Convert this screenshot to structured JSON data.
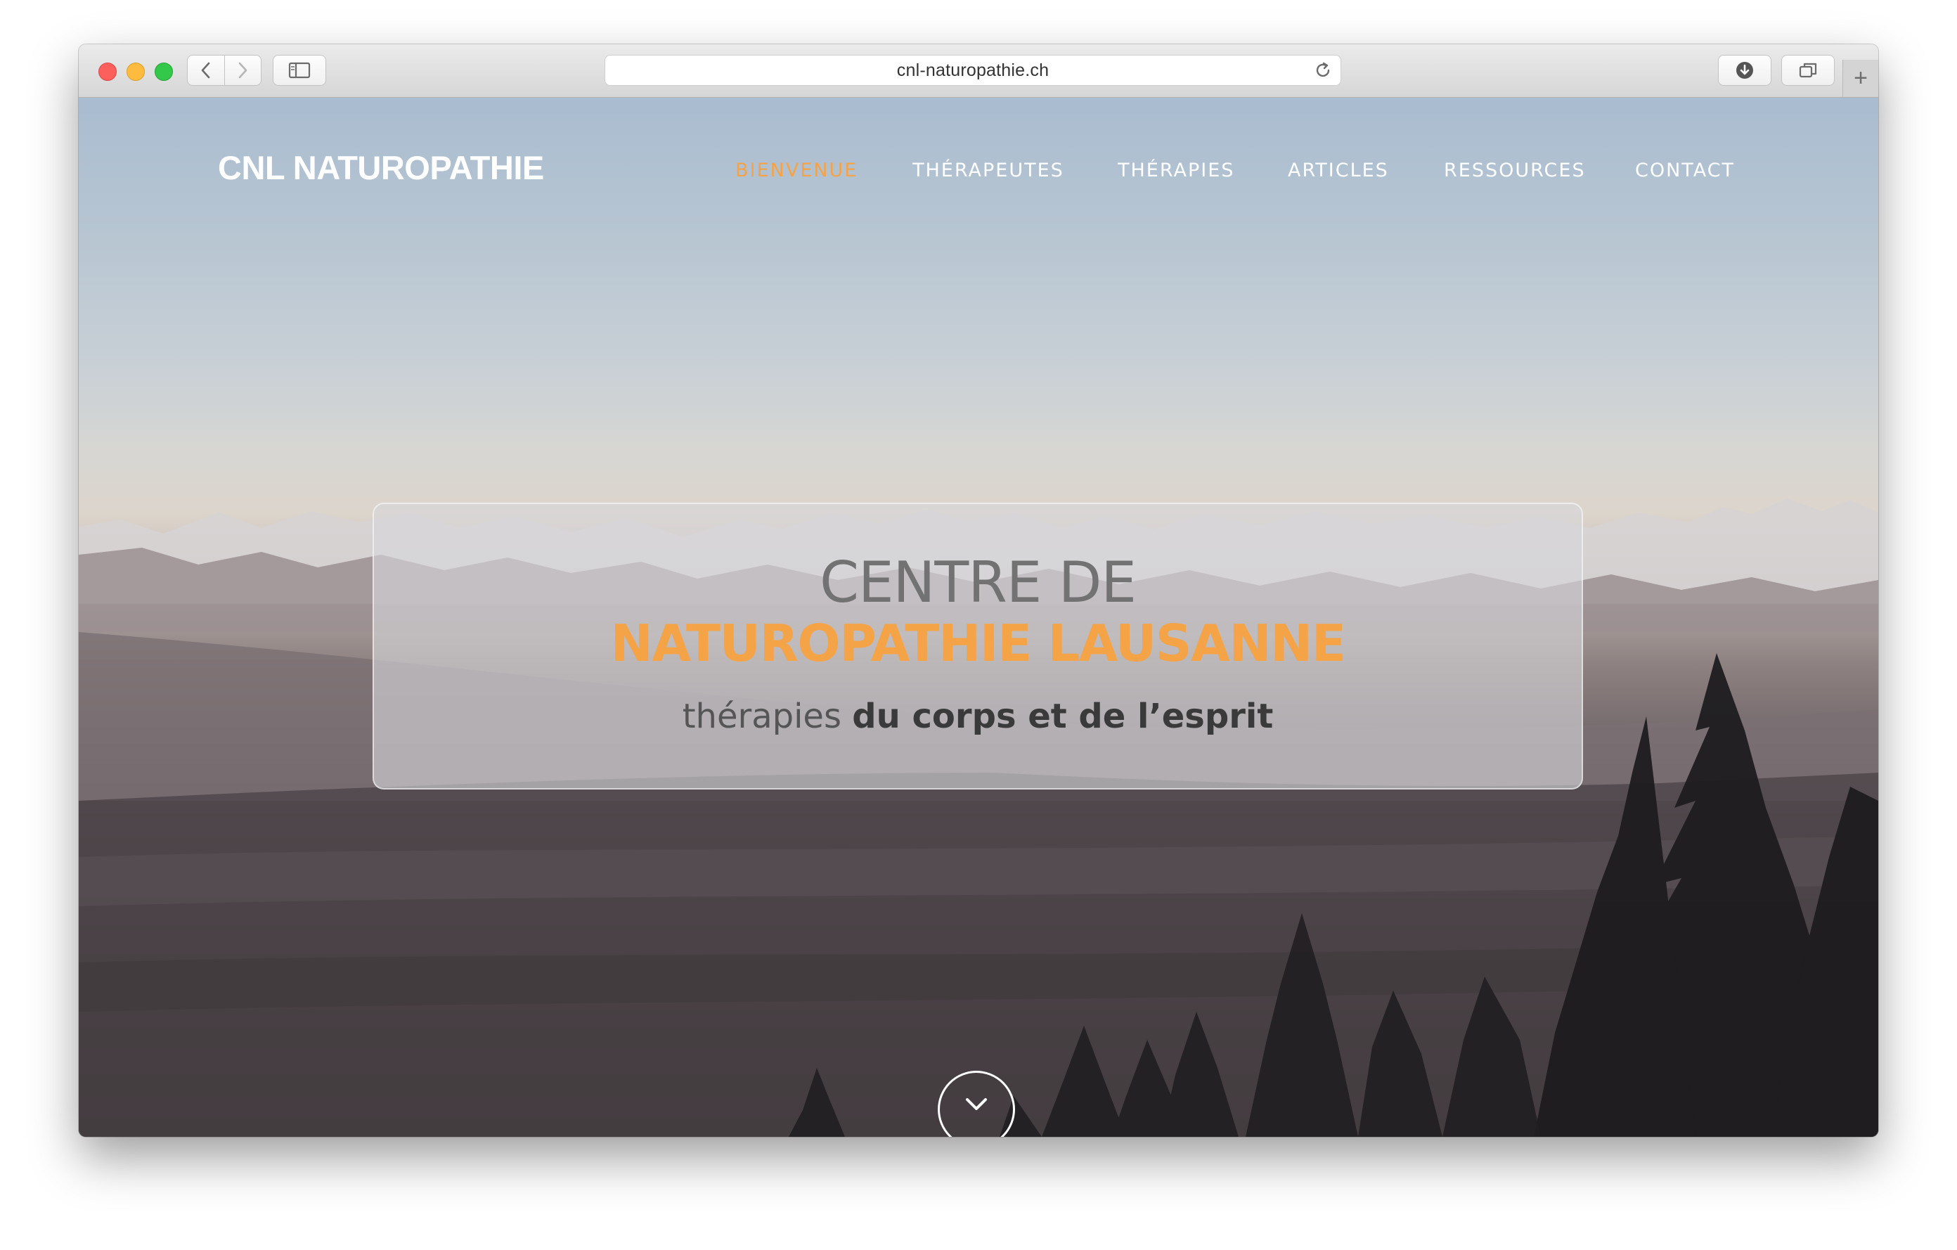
{
  "browser": {
    "url": "cnl-naturopathie.ch"
  },
  "site": {
    "logo": "CNL NATUROPATHIE",
    "nav": [
      {
        "label": "BIENVENUE",
        "active": true
      },
      {
        "label": "THÉRAPEUTES",
        "active": false
      },
      {
        "label": "THÉRAPIES",
        "active": false
      },
      {
        "label": "ARTICLES",
        "active": false
      },
      {
        "label": "RESSOURCES",
        "active": false
      },
      {
        "label": "CONTACT",
        "active": false
      }
    ],
    "hero": {
      "line1": "CENTRE DE",
      "line2": "NATUROPATHIE LAUSANNE",
      "line3_light": "thérapies",
      "line3_bold": "du corps et de l’esprit"
    },
    "scroll_icon": "chevron-down-icon"
  },
  "colors": {
    "accent": "#f4a347",
    "nav_text": "#ffffff"
  }
}
